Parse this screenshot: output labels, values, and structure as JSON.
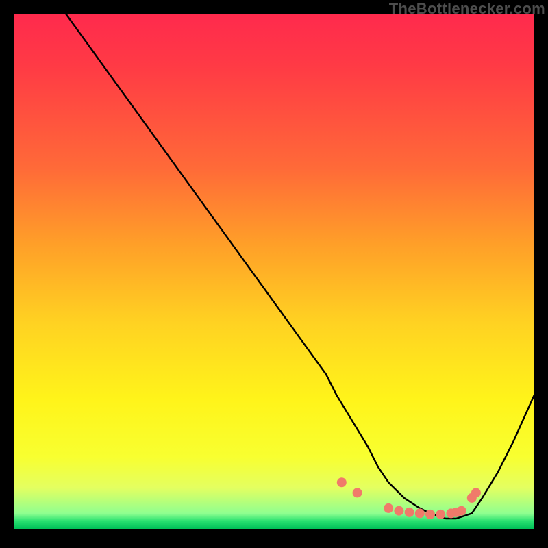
{
  "attribution": "TheBottlenecker.com",
  "colors": {
    "top": "#ff2a4d",
    "mid": "#ffd222",
    "bottom_accent": "#28e070",
    "curve": "#000000",
    "marker": "#f07a6a"
  },
  "chart_data": {
    "type": "line",
    "title": "",
    "xlabel": "",
    "ylabel": "",
    "xlim": [
      0,
      100
    ],
    "ylim": [
      0,
      100
    ],
    "series": [
      {
        "name": "curve",
        "x": [
          10,
          15,
          20,
          25,
          30,
          35,
          40,
          45,
          50,
          55,
          60,
          62,
          65,
          68,
          70,
          72,
          75,
          78,
          80,
          83,
          85,
          88,
          90,
          93,
          96,
          100
        ],
        "y": [
          100,
          93,
          86,
          79,
          72,
          65,
          58,
          51,
          44,
          37,
          30,
          26,
          21,
          16,
          12,
          9,
          6,
          4,
          3,
          2,
          2,
          3,
          6,
          11,
          17,
          26
        ]
      }
    ],
    "markers": {
      "name": "highlight-dots",
      "x": [
        63,
        66,
        72,
        74,
        76,
        78,
        80,
        82,
        84,
        85,
        86,
        88,
        88.8
      ],
      "y": [
        9,
        7,
        4,
        3.5,
        3.2,
        3,
        2.8,
        2.8,
        3,
        3.2,
        3.5,
        6,
        7
      ]
    }
  }
}
